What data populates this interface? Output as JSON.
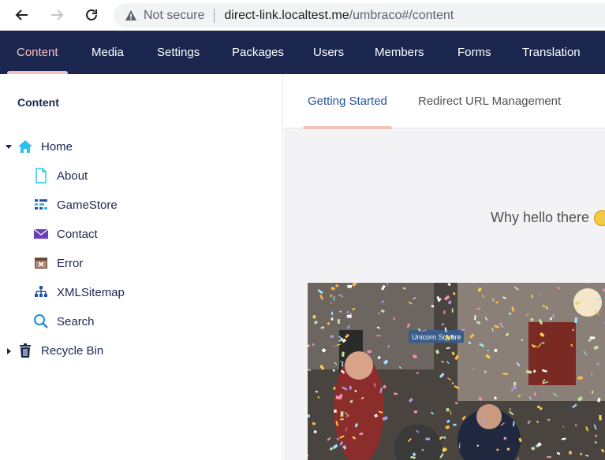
{
  "browser": {
    "security_label": "Not secure",
    "url_host": "direct-link.localtest.me",
    "url_path": "/umbraco#/content"
  },
  "topnav": {
    "items": [
      {
        "label": "Content",
        "active": true
      },
      {
        "label": "Media"
      },
      {
        "label": "Settings"
      },
      {
        "label": "Packages"
      },
      {
        "label": "Users"
      },
      {
        "label": "Members"
      },
      {
        "label": "Forms"
      },
      {
        "label": "Translation"
      }
    ]
  },
  "sidebar": {
    "title": "Content",
    "tree": [
      {
        "label": "Home",
        "icon": "home-icon",
        "expanded": true
      },
      {
        "label": "About",
        "icon": "document-icon"
      },
      {
        "label": "GameStore",
        "icon": "grid-list-icon"
      },
      {
        "label": "Contact",
        "icon": "envelope-icon"
      },
      {
        "label": "Error",
        "icon": "error-window-icon"
      },
      {
        "label": "XMLSitemap",
        "icon": "sitemap-icon"
      },
      {
        "label": "Search",
        "icon": "search-icon"
      },
      {
        "label": "Recycle Bin",
        "icon": "trash-icon",
        "expanded": false
      }
    ]
  },
  "main": {
    "tabs": [
      {
        "label": "Getting Started",
        "active": true
      },
      {
        "label": "Redirect URL Management"
      }
    ],
    "welcome_text": "Why hello there"
  },
  "colors": {
    "topnav_bg": "#1b264f",
    "accent_pink": "#f5c1bc",
    "active_tab_text": "#2152a3",
    "main_bg": "#f3f3f5"
  }
}
